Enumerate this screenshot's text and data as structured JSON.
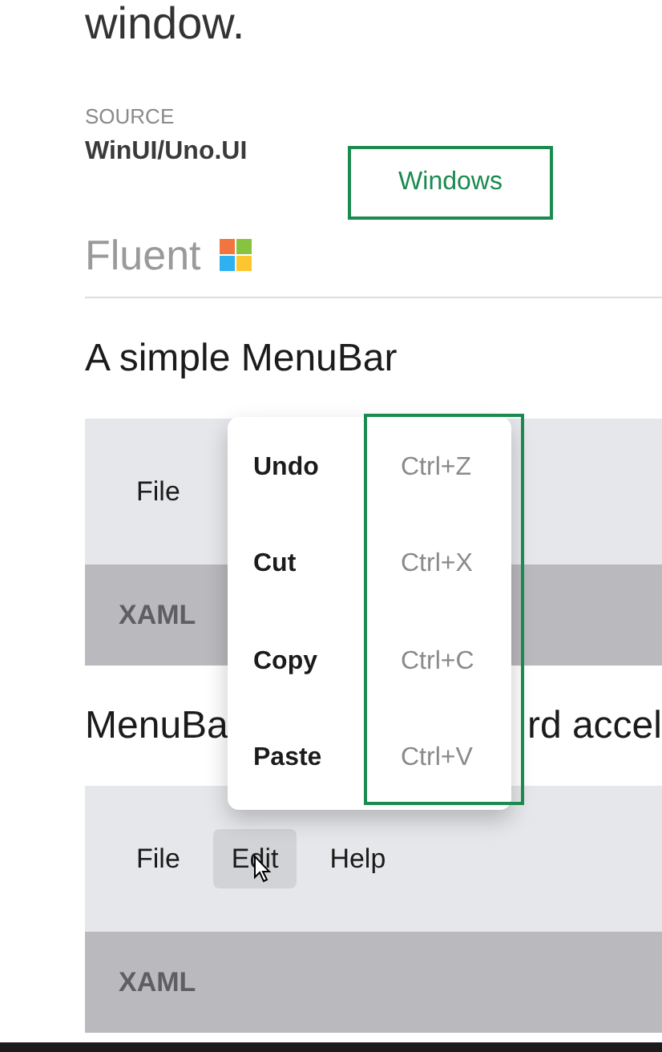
{
  "intro_tail": "window.",
  "source": {
    "label": "SOURCE",
    "value": "WinUI/Uno.UI"
  },
  "platform_button": "Windows",
  "design": {
    "label": "Fluent"
  },
  "sections": [
    {
      "heading_parts": [
        "A simple MenuBar"
      ],
      "menu_bar": [
        {
          "label": "File",
          "selected": false
        }
      ],
      "code_tab": "XAML"
    },
    {
      "heading_parts": [
        "MenuBa",
        "rd accel"
      ],
      "menu_bar": [
        {
          "label": "File",
          "selected": false
        },
        {
          "label": "Edit",
          "selected": true
        },
        {
          "label": "Help",
          "selected": false
        }
      ],
      "code_tab": "XAML"
    }
  ],
  "flyout": {
    "items": [
      {
        "label": "Undo",
        "shortcut": "Ctrl+Z"
      },
      {
        "label": "Cut",
        "shortcut": "Ctrl+X"
      },
      {
        "label": "Copy",
        "shortcut": "Ctrl+C"
      },
      {
        "label": "Paste",
        "shortcut": "Ctrl+V"
      }
    ]
  }
}
